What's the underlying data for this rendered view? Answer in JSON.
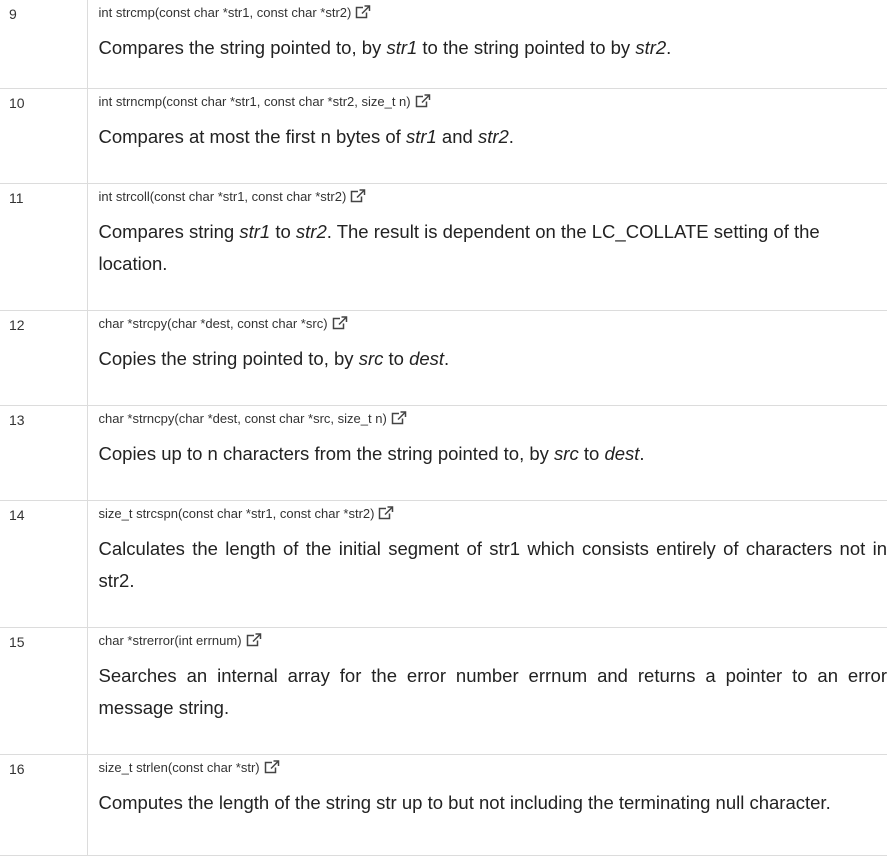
{
  "rows": [
    {
      "num": "9",
      "signature": "int strcmp(const char *str1, const char *str2)",
      "link_icon": "external-link-icon",
      "description": [
        {
          "t": "Compares the string pointed to, by ",
          "i": false
        },
        {
          "t": "str1",
          "i": true
        },
        {
          "t": " to the string pointed to by ",
          "i": false
        },
        {
          "t": "str2",
          "i": true
        },
        {
          "t": ".",
          "i": false
        }
      ]
    },
    {
      "num": "10",
      "signature": "int strncmp(const char *str1, const char *str2, size_t n)",
      "link_icon": "external-link-icon",
      "description": [
        {
          "t": "Compares at most the first n bytes of ",
          "i": false
        },
        {
          "t": "str1",
          "i": true
        },
        {
          "t": " and ",
          "i": false
        },
        {
          "t": "str2",
          "i": true
        },
        {
          "t": ".",
          "i": false
        }
      ]
    },
    {
      "num": "11",
      "signature": "int strcoll(const char *str1, const char *str2)",
      "link_icon": "external-link-icon",
      "description": [
        {
          "t": "Compares string ",
          "i": false
        },
        {
          "t": "str1",
          "i": true
        },
        {
          "t": " to ",
          "i": false
        },
        {
          "t": "str2",
          "i": true
        },
        {
          "t": ". The result is dependent on the LC_COLLATE setting of the location.",
          "i": false
        }
      ]
    },
    {
      "num": "12",
      "signature": "char *strcpy(char *dest, const char *src)",
      "link_icon": "external-link-icon",
      "description": [
        {
          "t": "Copies the string pointed to, by ",
          "i": false
        },
        {
          "t": "src",
          "i": true
        },
        {
          "t": " to ",
          "i": false
        },
        {
          "t": "dest",
          "i": true
        },
        {
          "t": ".",
          "i": false
        }
      ]
    },
    {
      "num": "13",
      "signature": "char *strncpy(char *dest, const char *src, size_t n)",
      "link_icon": "external-link-icon",
      "description": [
        {
          "t": "Copies up to n characters from the string pointed to, by ",
          "i": false
        },
        {
          "t": "src",
          "i": true
        },
        {
          "t": " to ",
          "i": false
        },
        {
          "t": "dest",
          "i": true
        },
        {
          "t": ".",
          "i": false
        }
      ]
    },
    {
      "num": "14",
      "signature": "size_t strcspn(const char *str1, const char *str2)",
      "link_icon": "external-link-icon",
      "description": [
        {
          "t": "Calculates the length of the initial segment of str1 which consists entirely of characters not in str2.",
          "i": false
        }
      ]
    },
    {
      "num": "15",
      "signature": "char *strerror(int errnum)",
      "link_icon": "external-link-icon",
      "description": [
        {
          "t": "Searches an internal array for the error number errnum and returns a pointer to an error message string.",
          "i": false
        }
      ]
    },
    {
      "num": "16",
      "signature": "size_t strlen(const char *str)",
      "link_icon": "external-link-icon",
      "description": [
        {
          "t": "Computes the length of the string str up to but not including the terminating null character.",
          "i": false
        }
      ]
    }
  ]
}
